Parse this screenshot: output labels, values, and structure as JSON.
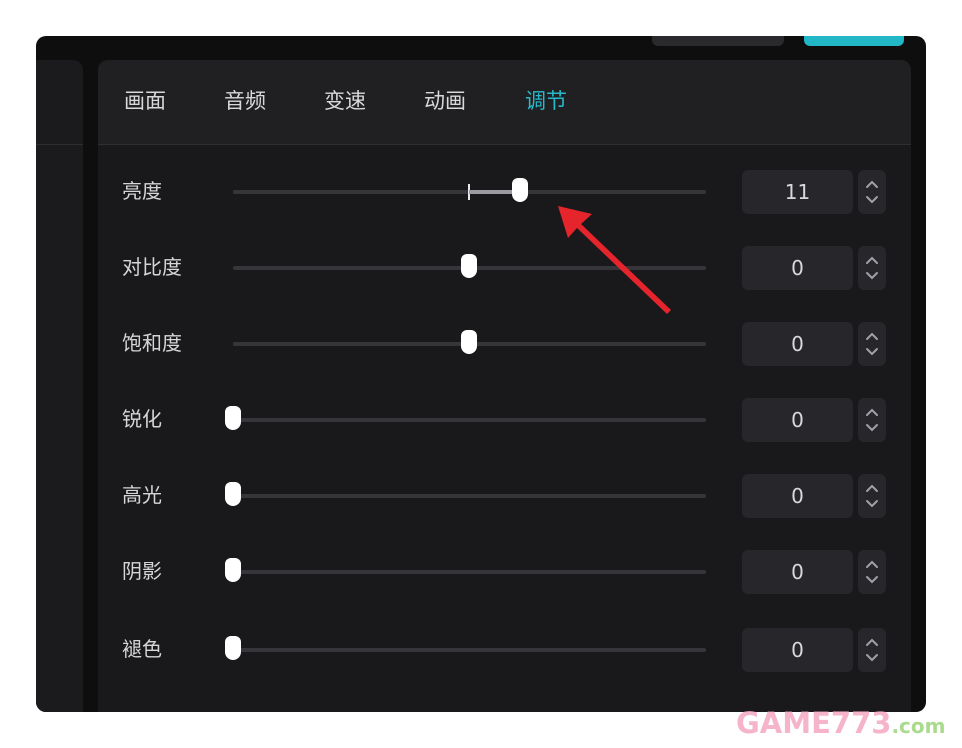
{
  "tabs": [
    {
      "label": "画面"
    },
    {
      "label": "音频"
    },
    {
      "label": "变速"
    },
    {
      "label": "动画"
    },
    {
      "label": "调节",
      "active": true
    }
  ],
  "adjustments": [
    {
      "label": "亮度",
      "value": "11"
    },
    {
      "label": "对比度",
      "value": "0"
    },
    {
      "label": "饱和度",
      "value": "0"
    },
    {
      "label": "锐化",
      "value": "0"
    },
    {
      "label": "高光",
      "value": "0"
    },
    {
      "label": "阴影",
      "value": "0"
    },
    {
      "label": "褪色",
      "value": "0"
    }
  ],
  "colors": {
    "accent": "#26b9cb",
    "annotation_arrow": "#e5242b"
  },
  "watermark": {
    "main": "GAME773",
    "suffix": ".com"
  }
}
